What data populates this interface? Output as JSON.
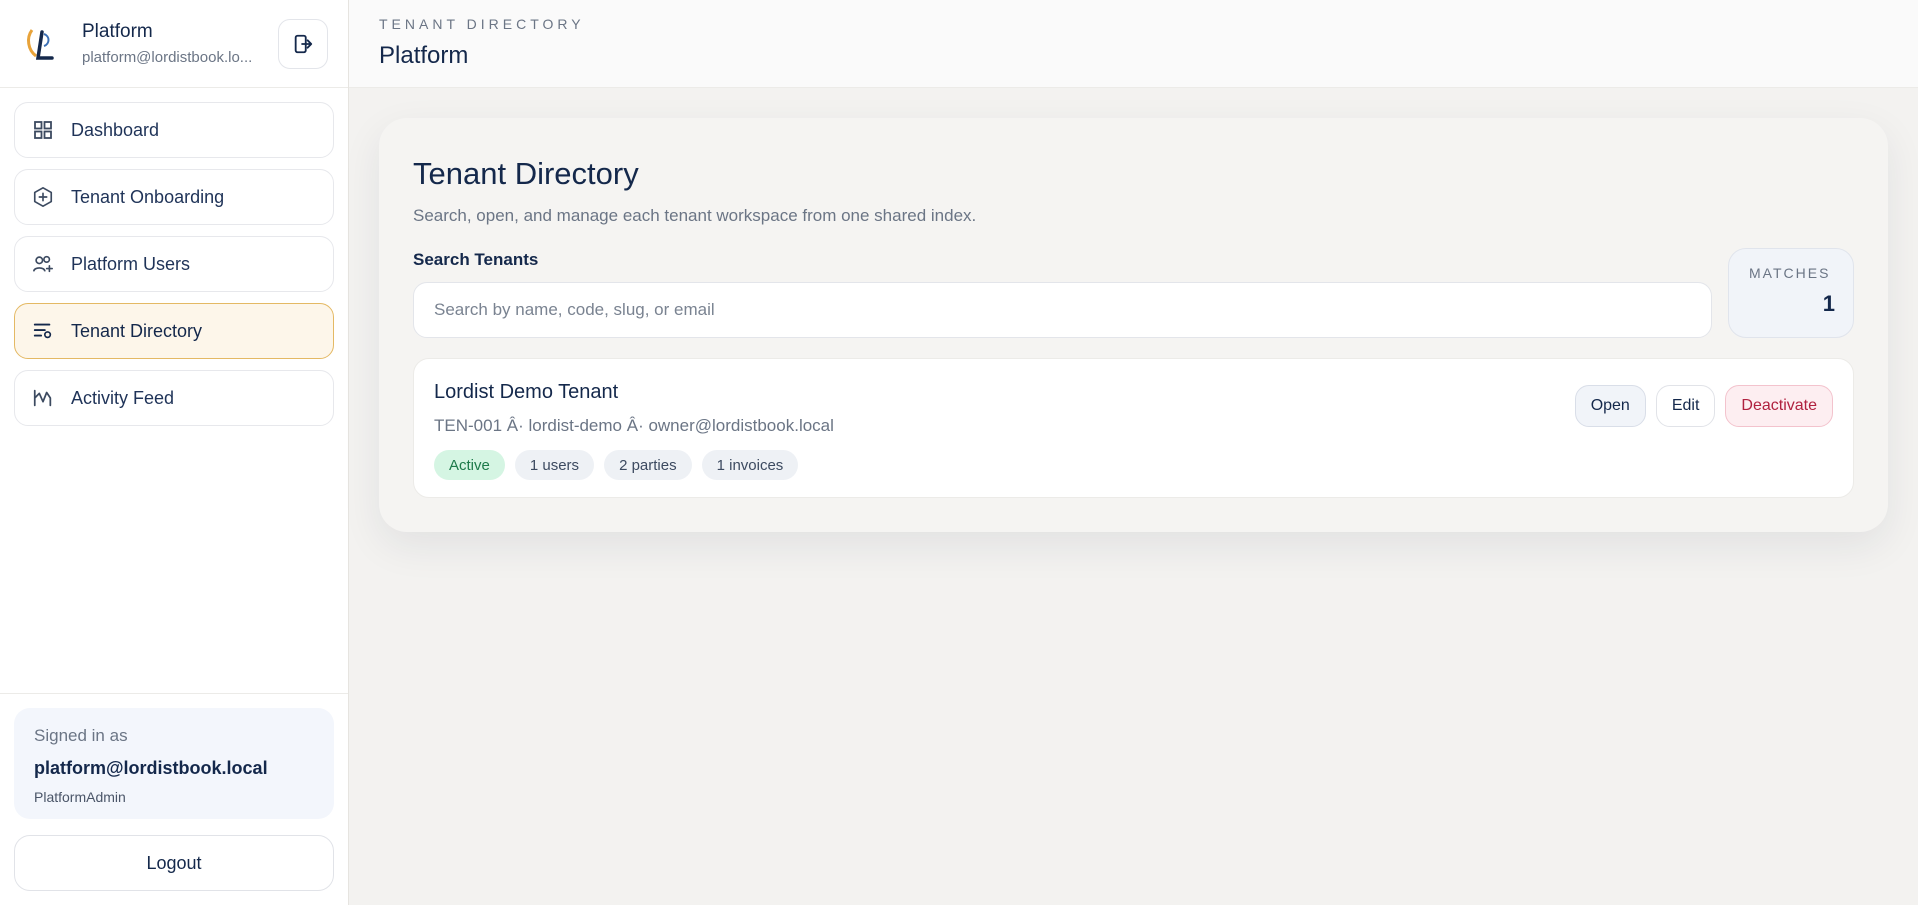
{
  "brand": {
    "name": "Platform",
    "email": "platform@lordistbook.lo..."
  },
  "nav": [
    {
      "label": "Dashboard",
      "icon": "grid-icon"
    },
    {
      "label": "Tenant Onboarding",
      "icon": "hexagon-plus-icon"
    },
    {
      "label": "Platform Users",
      "icon": "users-plus-icon"
    },
    {
      "label": "Tenant Directory",
      "icon": "list-filter-icon",
      "active": true
    },
    {
      "label": "Activity Feed",
      "icon": "activity-icon"
    }
  ],
  "signed": {
    "label": "Signed in as",
    "email": "platform@lordistbook.local",
    "role": "PlatformAdmin"
  },
  "logout_label": "Logout",
  "topbar": {
    "eyebrow": "TENANT DIRECTORY",
    "title": "Platform"
  },
  "panel": {
    "title": "Tenant Directory",
    "subtitle": "Search, open, and manage each tenant workspace from one shared index.",
    "search_label": "Search Tenants",
    "search_placeholder": "Search by name, code, slug, or email",
    "search_value": "",
    "matches_label": "MATCHES",
    "matches_value": "1"
  },
  "tenants": [
    {
      "name": "Lordist Demo Tenant",
      "meta": "TEN-001 Â· lordist-demo Â· owner@lordistbook.local",
      "tags": [
        "Active",
        "1 users",
        "2 parties",
        "1 invoices"
      ],
      "actions": {
        "open": "Open",
        "edit": "Edit",
        "deactivate": "Deactivate"
      }
    }
  ],
  "colors": {
    "accent_border": "#e4b964",
    "active_bg": "#fdf6ea",
    "primary_text": "#14284b",
    "status_active": "#1d7a4a",
    "danger": "#b0213f"
  }
}
